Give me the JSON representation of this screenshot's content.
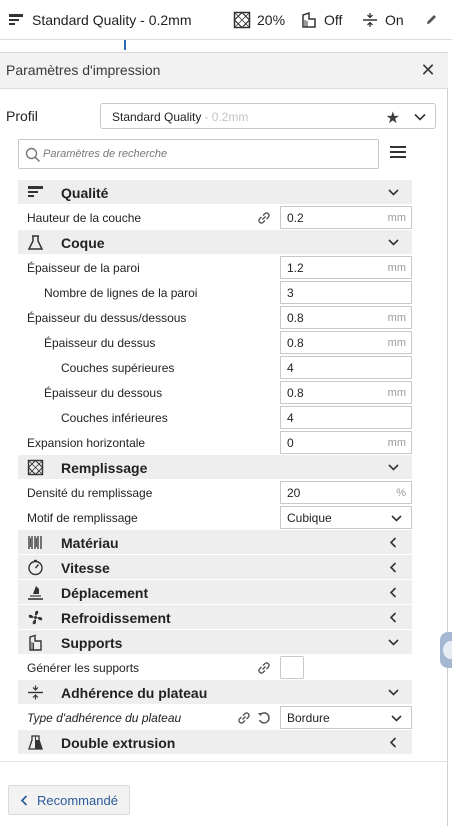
{
  "topbar": {
    "profile": "Standard Quality - 0.2mm",
    "infill": "20%",
    "support": "Off",
    "adhesion": "On"
  },
  "panel": {
    "title": "Paramètres d'impression",
    "profile_label": "Profil",
    "profile_value": "Standard Quality",
    "profile_sub": "- 0.2mm",
    "search_placeholder": "Paramètres de recherche"
  },
  "categories": {
    "quality": "Qualité",
    "shell": "Coque",
    "infill": "Remplissage",
    "material": "Matériau",
    "speed": "Vitesse",
    "travel": "Déplacement",
    "cooling": "Refroidissement",
    "supports": "Supports",
    "adhesion": "Adhérence du plateau",
    "dual": "Double extrusion"
  },
  "settings": {
    "layer_height": {
      "label": "Hauteur de la couche",
      "value": "0.2",
      "unit": "mm"
    },
    "wall_thickness": {
      "label": "Épaisseur de la paroi",
      "value": "1.2",
      "unit": "mm"
    },
    "wall_lines": {
      "label": "Nombre de lignes de la paroi",
      "value": "3"
    },
    "top_bottom": {
      "label": "Épaisseur du dessus/dessous",
      "value": "0.8",
      "unit": "mm"
    },
    "top_thickness": {
      "label": "Épaisseur du dessus",
      "value": "0.8",
      "unit": "mm"
    },
    "top_layers": {
      "label": "Couches supérieures",
      "value": "4"
    },
    "bottom_thickness": {
      "label": "Épaisseur du dessous",
      "value": "0.8",
      "unit": "mm"
    },
    "bottom_layers": {
      "label": "Couches inférieures",
      "value": "4"
    },
    "horizontal_expansion": {
      "label": "Expansion horizontale",
      "value": "0",
      "unit": "mm"
    },
    "infill_density": {
      "label": "Densité du remplissage",
      "value": "20",
      "unit": "%"
    },
    "infill_pattern": {
      "label": "Motif de remplissage",
      "value": "Cubique"
    },
    "generate_supports": {
      "label": "Générer les supports"
    },
    "adhesion_type": {
      "label": "Type d'adhérence du plateau",
      "value": "Bordure"
    }
  },
  "footer": {
    "recommended": "Recommandé"
  },
  "colors": {
    "accent": "#2d5a9a",
    "category_bg": "#eeeeee",
    "field_border": "#c8c8c8"
  }
}
